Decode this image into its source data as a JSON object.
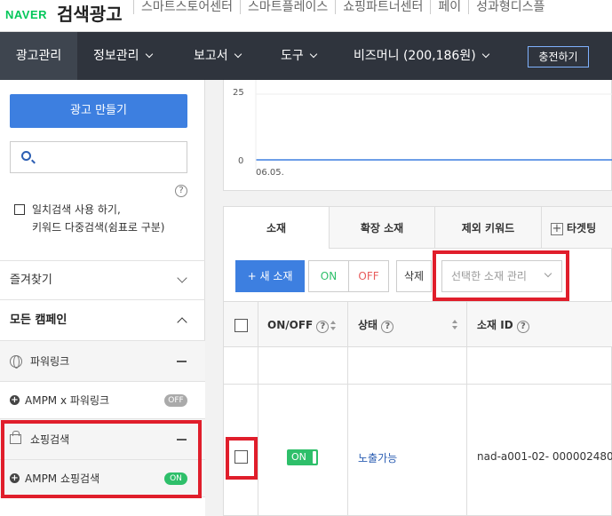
{
  "topbar": {
    "naver_logo": "NAVER",
    "title": "검색광고",
    "links": [
      "스마트스토어센터",
      "스마트플레이스",
      "쇼핑파트너센터",
      "페이",
      "성과형디스플"
    ]
  },
  "nav": {
    "items": [
      "광고관리",
      "정보관리",
      "보고서",
      "도구",
      "비즈머니 (200,186원)"
    ],
    "charge_button": "충전하기"
  },
  "sidebar": {
    "create_button": "광고 만들기",
    "search_placeholder": "",
    "help_icon": "?",
    "exact_search_line1": "일치검색 사용 하기,",
    "exact_search_line2": "키워드 다중검색(쉼표로 구분)",
    "favorites": "즐겨찾기",
    "all_campaigns": "모든 캠페인",
    "groups": [
      {
        "name": "파워링크",
        "icon": "globe-icon",
        "sub": {
          "name": "AMPM x 파워링크",
          "status": "OFF"
        }
      },
      {
        "name": "쇼핑검색",
        "icon": "shopping-bag-icon",
        "sub": {
          "name": "AMPM 쇼핑검색",
          "status": "ON"
        }
      }
    ]
  },
  "chart": {
    "y_ticks": [
      "25",
      "0"
    ],
    "x_tick": "06.05."
  },
  "tabs": {
    "items": [
      "소재",
      "확장 소재",
      "제외 키워드",
      "타겟팅"
    ]
  },
  "toolbar": {
    "new_creative": "+ 새 소재",
    "on": "ON",
    "off": "OFF",
    "delete": "삭제",
    "manage_select": "선택한 소재 관리"
  },
  "table": {
    "headers": [
      "ON/OFF",
      "상태",
      "소재 ID"
    ],
    "row": {
      "toggle": "ON",
      "status": "노출가능",
      "id": "nad-a001-02- 000002480"
    }
  },
  "colors": {
    "accent_blue": "#3d7fe0",
    "nav_dark": "#2f343d",
    "on_green": "#2ebf6a",
    "highlight_red": "#e01e2b"
  }
}
